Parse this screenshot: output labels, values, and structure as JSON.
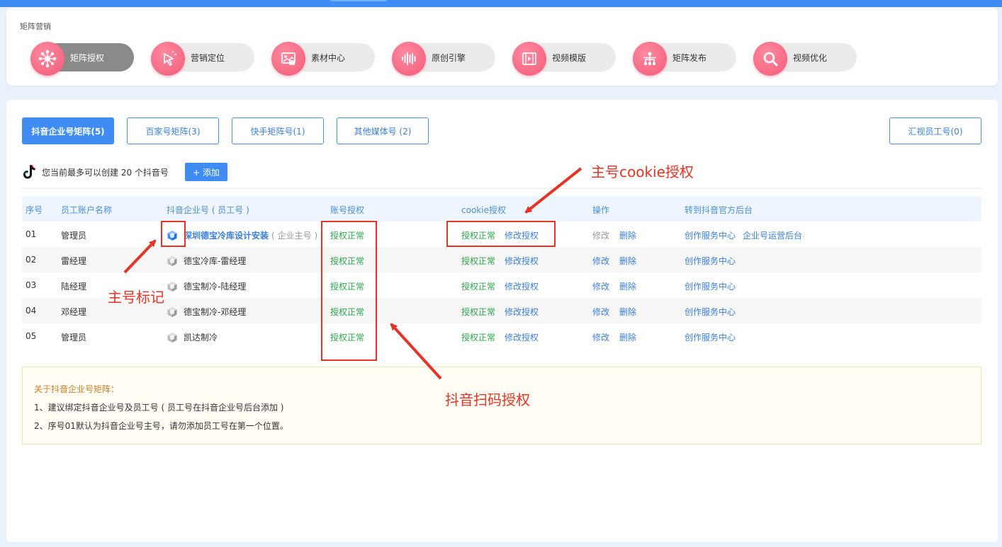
{
  "header": {
    "section_title": "矩阵营销",
    "modules": [
      {
        "label": "矩阵授权",
        "icon": "network-hub-icon",
        "active": true
      },
      {
        "label": "营销定位",
        "icon": "cursor-click-icon",
        "active": false
      },
      {
        "label": "素材中心",
        "icon": "media-library-icon",
        "active": false
      },
      {
        "label": "原创引擎",
        "icon": "sound-wave-icon",
        "active": false
      },
      {
        "label": "视频模版",
        "icon": "video-film-icon",
        "active": false
      },
      {
        "label": "矩阵发布",
        "icon": "org-tree-icon",
        "active": false
      },
      {
        "label": "视频优化",
        "icon": "magnifier-icon",
        "active": false
      }
    ]
  },
  "tabs": [
    {
      "label": "抖音企业号矩阵(5)",
      "active": true
    },
    {
      "label": "百家号矩阵(3)",
      "active": false
    },
    {
      "label": "快手矩阵号(1)",
      "active": false
    },
    {
      "label": "其他媒体号 (2)",
      "active": false
    }
  ],
  "summary_button": "汇视员工号(0)",
  "toolbar": {
    "limit_text": "您当前最多可以创建 20 个抖音号",
    "add_button": "+ 添加"
  },
  "table": {
    "headers": [
      "序号",
      "员工账户名称",
      "抖音企业号 ( 员工号 )",
      "账号授权",
      "cookie授权",
      "操作",
      "转到抖音官方后台"
    ],
    "rows": [
      {
        "no": "01",
        "name": "管理员",
        "account": "深圳德宝冷库设计安装",
        "tag": "( 企业主号 )",
        "main": true,
        "auth": "授权正常",
        "cookie": "授权正常",
        "cookie_edit": "修改授权",
        "edit": "修改",
        "delete": "删除",
        "link1": "创作服务中心",
        "link2": "企业号运营后台"
      },
      {
        "no": "02",
        "name": "雷经理",
        "account": "德宝冷库-雷经理",
        "tag": "",
        "main": false,
        "auth": "授权正常",
        "cookie": "授权正常",
        "cookie_edit": "修改授权",
        "edit": "修改",
        "delete": "删除",
        "link1": "创作服务中心",
        "link2": ""
      },
      {
        "no": "03",
        "name": "陆经理",
        "account": "德宝制冷-陆经理",
        "tag": "",
        "main": false,
        "auth": "授权正常",
        "cookie": "授权正常",
        "cookie_edit": "修改授权",
        "edit": "修改",
        "delete": "删除",
        "link1": "创作服务中心",
        "link2": ""
      },
      {
        "no": "04",
        "name": "邓经理",
        "account": "德宝制冷-邓经理",
        "tag": "",
        "main": false,
        "auth": "授权正常",
        "cookie": "授权正常",
        "cookie_edit": "修改授权",
        "edit": "修改",
        "delete": "删除",
        "link1": "创作服务中心",
        "link2": ""
      },
      {
        "no": "05",
        "name": "管理员",
        "account": "凯达制冷",
        "tag": "",
        "main": false,
        "auth": "授权正常",
        "cookie": "授权正常",
        "cookie_edit": "修改授权",
        "edit": "修改",
        "delete": "删除",
        "link1": "创作服务中心",
        "link2": ""
      }
    ]
  },
  "notice": {
    "title": "关于抖音企业号矩阵：",
    "lines": [
      "1、建议绑定抖音企业号及员工号 ( 员工号在抖音企业号后台添加 )",
      "2、序号01默认为抖音企业号主号，请勿添加员工号在第一个位置。"
    ]
  },
  "annotations": {
    "cookie_label": "主号cookie授权",
    "main_mark_label": "主号标记",
    "scan_label": "抖音扫码授权",
    "color": "#e63326"
  },
  "colors": {
    "primary": "#3f8cf5",
    "success": "#2ba64b",
    "accent_pink": "#f35a77"
  }
}
